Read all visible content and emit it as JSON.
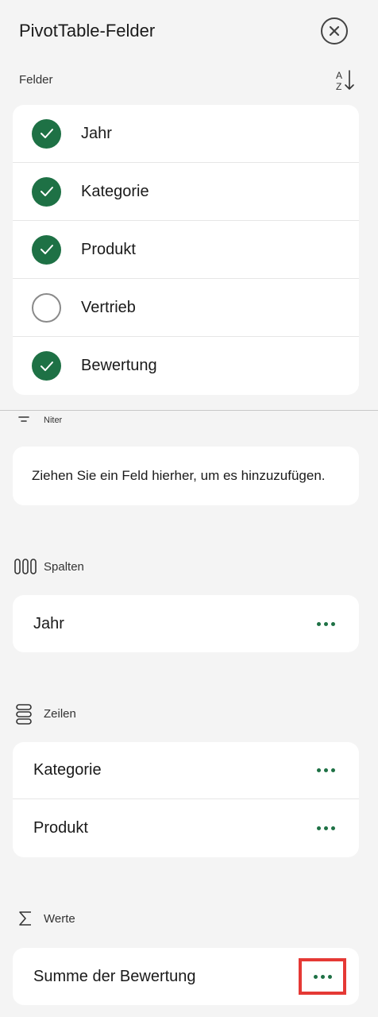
{
  "header": {
    "title": "PivotTable-Felder"
  },
  "fields": {
    "label": "Felder",
    "items": [
      {
        "label": "Jahr",
        "checked": true
      },
      {
        "label": "Kategorie",
        "checked": true
      },
      {
        "label": "Produkt",
        "checked": true
      },
      {
        "label": "Vertrieb",
        "checked": false
      },
      {
        "label": "Bewertung",
        "checked": true
      }
    ]
  },
  "filters": {
    "label": "Niter",
    "placeholder": "Ziehen Sie ein Feld hierher, um es hinzuzufügen."
  },
  "columns": {
    "label": "Spalten",
    "items": [
      {
        "label": "Jahr"
      }
    ]
  },
  "rows": {
    "label": "Zeilen",
    "items": [
      {
        "label": "Kategorie"
      },
      {
        "label": "Produkt"
      }
    ]
  },
  "values": {
    "label": "Werte",
    "items": [
      {
        "label": "Summe der Bewertung"
      }
    ]
  },
  "colors": {
    "accent": "#1e7145",
    "highlight": "#e53935"
  }
}
